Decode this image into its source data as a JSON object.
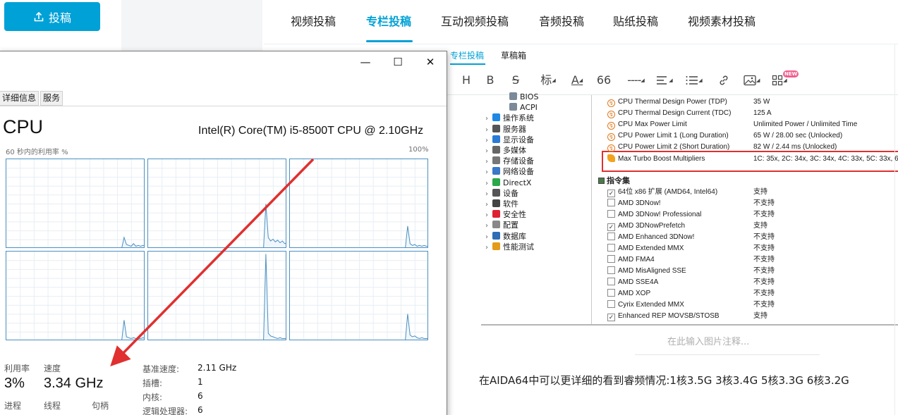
{
  "upload_button": {
    "label": "投稿"
  },
  "top_tabs": [
    {
      "label": "视频投稿",
      "active": false
    },
    {
      "label": "专栏投稿",
      "active": true
    },
    {
      "label": "互动视频投稿",
      "active": false
    },
    {
      "label": "音频投稿",
      "active": false
    },
    {
      "label": "贴纸投稿",
      "active": false
    },
    {
      "label": "视频素材投稿",
      "active": false
    }
  ],
  "editor_tabs": [
    {
      "label": "专栏投稿",
      "active": true
    },
    {
      "label": "草稿箱",
      "active": false
    }
  ],
  "toolbar": {
    "heading": "H",
    "bold": "B",
    "strike": "S",
    "mark": "标",
    "font_color": "A",
    "quote": "66",
    "divider": "----",
    "new_badge": "NEW",
    "icons": [
      "heading-icon",
      "bold-icon",
      "strikethrough-icon",
      "mark-icon",
      "font-color-icon",
      "quote-icon",
      "divider-icon",
      "align-icon",
      "list-icon",
      "link-icon",
      "image-icon",
      "blocks-icon"
    ]
  },
  "aida": {
    "tree": [
      {
        "label": "BIOS",
        "indent": 2,
        "icon": "chip-icon"
      },
      {
        "label": "ACPI",
        "indent": 2,
        "icon": "chip-icon"
      },
      {
        "label": "操作系统",
        "indent": 1,
        "icon": "windows-icon"
      },
      {
        "label": "服务器",
        "indent": 1,
        "icon": "server-icon"
      },
      {
        "label": "显示设备",
        "indent": 1,
        "icon": "monitor-icon"
      },
      {
        "label": "多媒体",
        "indent": 1,
        "icon": "media-icon"
      },
      {
        "label": "存储设备",
        "indent": 1,
        "icon": "disk-icon"
      },
      {
        "label": "网络设备",
        "indent": 1,
        "icon": "network-icon"
      },
      {
        "label": "DirectX",
        "indent": 1,
        "icon": "directx-icon"
      },
      {
        "label": "设备",
        "indent": 1,
        "icon": "device-icon"
      },
      {
        "label": "软件",
        "indent": 1,
        "icon": "software-icon"
      },
      {
        "label": "安全性",
        "indent": 1,
        "icon": "shield-icon"
      },
      {
        "label": "配置",
        "indent": 1,
        "icon": "config-icon"
      },
      {
        "label": "数据库",
        "indent": 1,
        "icon": "database-icon"
      },
      {
        "label": "性能测试",
        "indent": 1,
        "icon": "benchmark-icon"
      }
    ],
    "power_props": [
      {
        "name": "CPU Thermal Design Power (TDP)",
        "value": "35 W"
      },
      {
        "name": "CPU Thermal Design Current (TDC)",
        "value": "125 A"
      },
      {
        "name": "CPU Max Power Limit",
        "value": "Unlimited Power / Unlimited Time"
      },
      {
        "name": "CPU Power Limit 1 (Long Duration)",
        "value": "65 W / 28.00 sec  (Unlocked)"
      },
      {
        "name": "CPU Power Limit 2 (Short Duration)",
        "value": "82 W / 2.44 ms  (Unlocked)"
      },
      {
        "name": "Max Turbo Boost Multipliers",
        "value": "1C: 35x, 2C: 34x, 3C: 34x, 4C: 33x, 5C: 33x, 6C: 3"
      }
    ],
    "section_title": "指令集",
    "instruction_sets": [
      {
        "name": "64位 x86 扩展 (AMD64, Intel64)",
        "value": "支持",
        "checked": true
      },
      {
        "name": "AMD 3DNow!",
        "value": "不支持",
        "checked": false
      },
      {
        "name": "AMD 3DNow! Professional",
        "value": "不支持",
        "checked": false
      },
      {
        "name": "AMD 3DNowPrefetch",
        "value": "支持",
        "checked": true
      },
      {
        "name": "AMD Enhanced 3DNow!",
        "value": "不支持",
        "checked": false
      },
      {
        "name": "AMD Extended MMX",
        "value": "不支持",
        "checked": false
      },
      {
        "name": "AMD FMA4",
        "value": "不支持",
        "checked": false
      },
      {
        "name": "AMD MisAligned SSE",
        "value": "不支持",
        "checked": false
      },
      {
        "name": "AMD SSE4A",
        "value": "不支持",
        "checked": false
      },
      {
        "name": "AMD XOP",
        "value": "不支持",
        "checked": false
      },
      {
        "name": "Cyrix Extended MMX",
        "value": "不支持",
        "checked": false
      },
      {
        "name": "Enhanced REP MOVSB/STOSB",
        "value": "支持",
        "checked": true
      }
    ]
  },
  "caption_placeholder": "在此输入图片注释...",
  "body_text": "在AIDA64中可以更详细的看到睿频情况:1核3.5G 3核3.4G 5核3.3G 6核3.2G",
  "task_manager": {
    "controls": {
      "minimize": "—",
      "maximize": "☐",
      "close": "✕"
    },
    "tabs": [
      "详细信息",
      "服务"
    ],
    "cpu_title": "CPU",
    "cpu_model": "Intel(R) Core(TM) i5-8500T CPU @ 2.10GHz",
    "graph_label": "60 秒内的利用率 %",
    "graph_max": "100%",
    "stats": {
      "util_label": "利用率",
      "util_value": "3%",
      "speed_label": "速度",
      "speed_value": "3.34 GHz",
      "process_label": "进程",
      "thread_label": "线程",
      "handle_label": "句柄"
    },
    "details": [
      {
        "k": "基准速度:",
        "v": "2.11 GHz"
      },
      {
        "k": "插槽:",
        "v": "1"
      },
      {
        "k": "内核:",
        "v": "6"
      },
      {
        "k": "逻辑处理器:",
        "v": "6"
      }
    ],
    "core_usage_peaks": [
      [
        0,
        0,
        0,
        0,
        0,
        0,
        0,
        0,
        0,
        0,
        0,
        0,
        0,
        0,
        0,
        0,
        0,
        0,
        0,
        0,
        0,
        0,
        0,
        0,
        0,
        0,
        0,
        0,
        0,
        0,
        0,
        0,
        0,
        0,
        0,
        0,
        0,
        0,
        0,
        0,
        0,
        0,
        0,
        0,
        0,
        0,
        0,
        0,
        0,
        0,
        12,
        4,
        3,
        2,
        5,
        2,
        3,
        2,
        3,
        2
      ],
      [
        0,
        0,
        0,
        0,
        0,
        0,
        0,
        0,
        0,
        0,
        0,
        0,
        0,
        0,
        0,
        0,
        0,
        0,
        0,
        0,
        0,
        0,
        0,
        0,
        0,
        0,
        0,
        0,
        0,
        0,
        0,
        0,
        0,
        0,
        0,
        0,
        0,
        0,
        0,
        0,
        0,
        0,
        0,
        0,
        0,
        0,
        0,
        0,
        0,
        0,
        50,
        12,
        8,
        10,
        7,
        9,
        6,
        8,
        5,
        6
      ],
      [
        0,
        0,
        0,
        0,
        0,
        0,
        0,
        0,
        0,
        0,
        0,
        0,
        0,
        0,
        0,
        0,
        0,
        0,
        0,
        0,
        0,
        0,
        0,
        0,
        0,
        0,
        0,
        0,
        0,
        0,
        0,
        0,
        0,
        0,
        0,
        0,
        0,
        0,
        0,
        0,
        0,
        0,
        0,
        0,
        0,
        0,
        0,
        0,
        0,
        0,
        25,
        5,
        3,
        4,
        2,
        3,
        2,
        3,
        2,
        2
      ],
      [
        0,
        0,
        0,
        0,
        0,
        0,
        0,
        0,
        0,
        0,
        0,
        0,
        0,
        0,
        0,
        0,
        0,
        0,
        0,
        0,
        0,
        0,
        0,
        0,
        0,
        0,
        0,
        0,
        0,
        0,
        0,
        0,
        0,
        0,
        0,
        0,
        0,
        0,
        0,
        0,
        0,
        0,
        0,
        0,
        0,
        0,
        0,
        0,
        0,
        0,
        23,
        4,
        3,
        2,
        3,
        2,
        2,
        2,
        3,
        2
      ],
      [
        0,
        0,
        0,
        0,
        0,
        0,
        0,
        0,
        0,
        0,
        0,
        0,
        0,
        0,
        0,
        0,
        0,
        0,
        0,
        0,
        0,
        0,
        0,
        0,
        0,
        0,
        0,
        0,
        0,
        0,
        0,
        0,
        0,
        0,
        0,
        0,
        0,
        0,
        0,
        0,
        0,
        0,
        0,
        0,
        0,
        0,
        0,
        0,
        0,
        0,
        98,
        8,
        5,
        4,
        3,
        2,
        3,
        2,
        2,
        2
      ],
      [
        0,
        0,
        0,
        0,
        0,
        0,
        0,
        0,
        0,
        0,
        0,
        0,
        0,
        0,
        0,
        0,
        0,
        0,
        0,
        0,
        0,
        0,
        0,
        0,
        0,
        0,
        0,
        0,
        0,
        0,
        0,
        0,
        0,
        0,
        0,
        0,
        0,
        0,
        0,
        0,
        0,
        0,
        0,
        0,
        0,
        0,
        0,
        0,
        0,
        0,
        30,
        6,
        4,
        5,
        3,
        2,
        3,
        2,
        2,
        2
      ]
    ]
  },
  "colors": {
    "accent": "#00a1d6",
    "arrow": "#e0302f",
    "graph_line": "#4a90c2"
  }
}
